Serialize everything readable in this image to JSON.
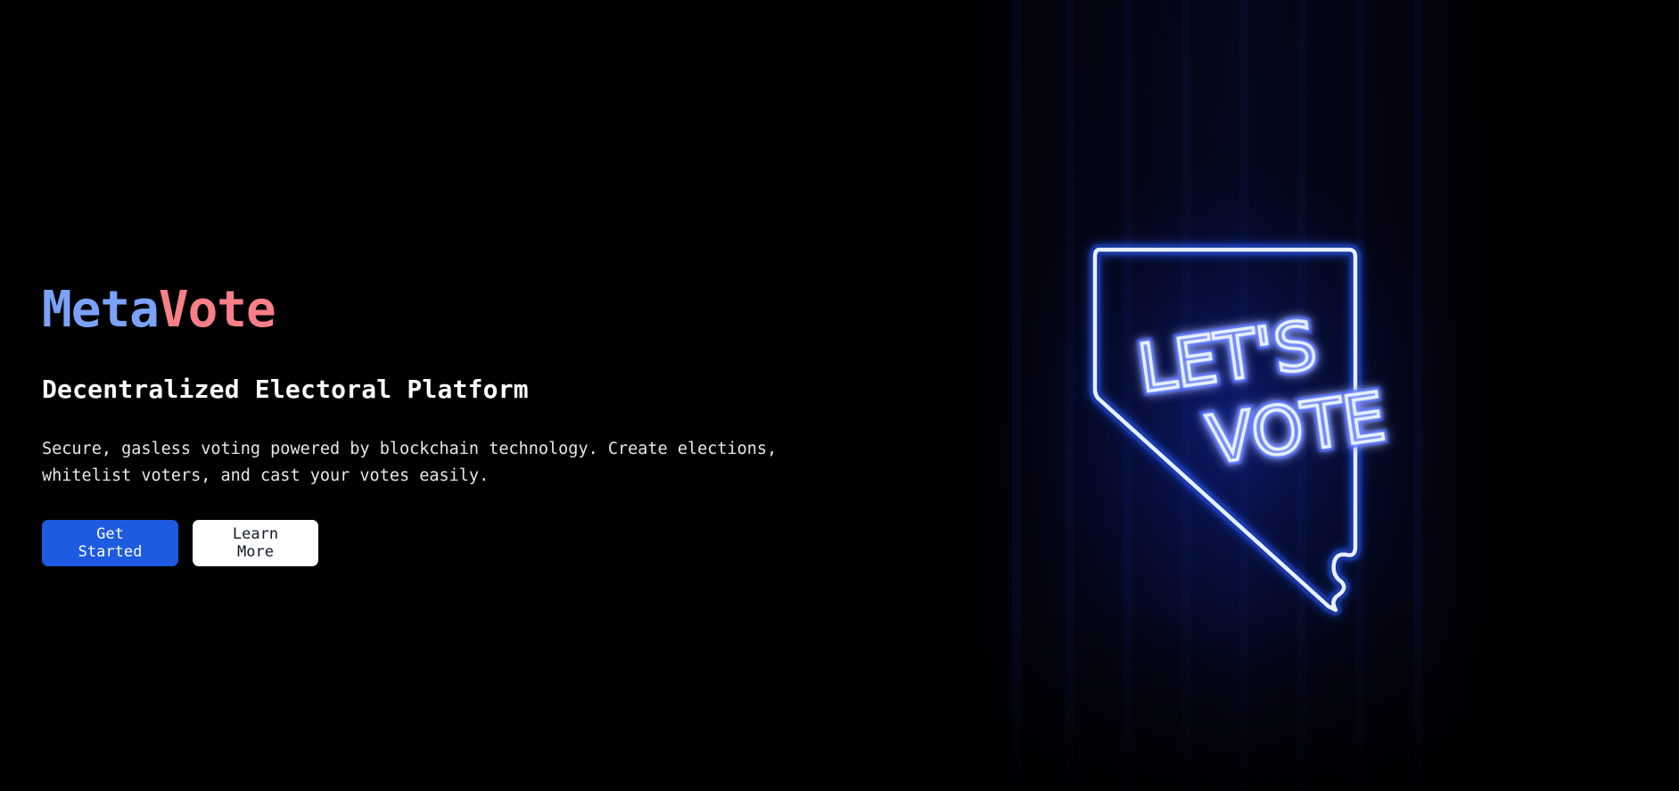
{
  "brand": {
    "prefix": "Meta",
    "suffix": "Vote",
    "prefix_color": "#7aa2f7",
    "suffix_color": "#f87f87"
  },
  "hero": {
    "subtitle": "Decentralized Electoral Platform",
    "description": "Secure, gasless voting powered by blockchain technology. Create elections, whitelist voters, and cast your votes easily.",
    "primary_button": "Get Started",
    "secondary_button": "Learn More",
    "primary_color": "#1d5be0"
  },
  "image": {
    "sign_line1": "LET'S",
    "sign_line2": "VOTE",
    "glow_color": "#3b6cff"
  }
}
